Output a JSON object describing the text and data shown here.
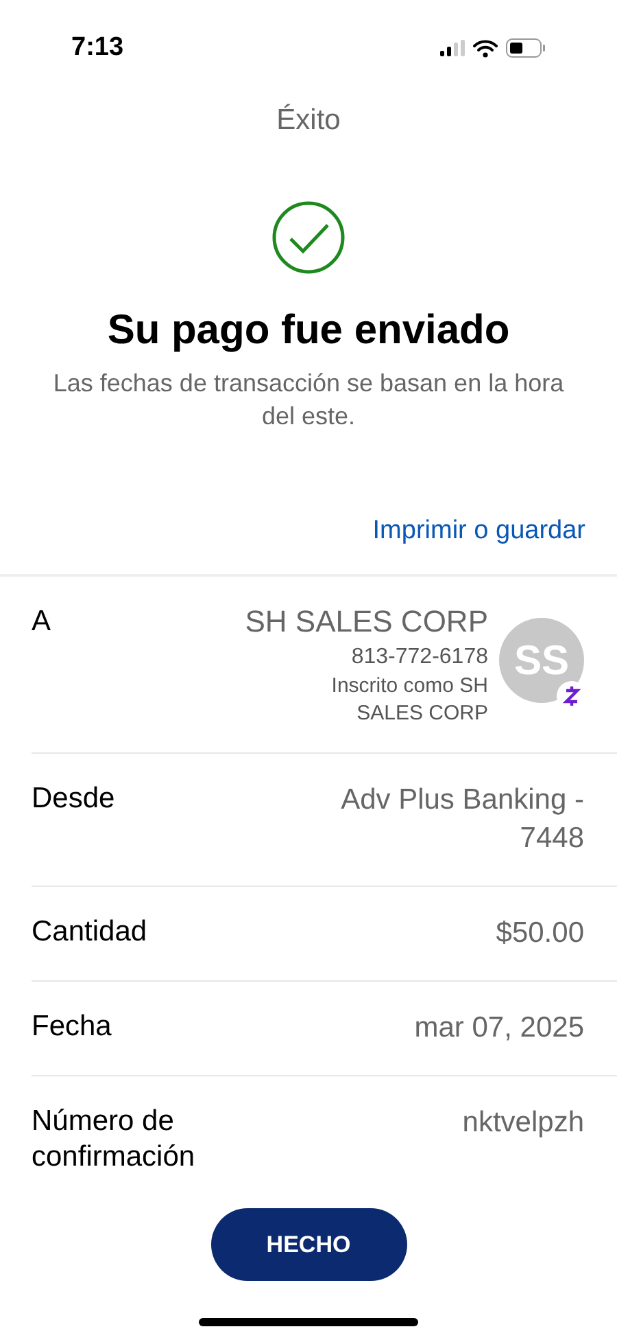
{
  "status_bar": {
    "time": "7:13"
  },
  "header": {
    "title": "Éxito"
  },
  "confirmation": {
    "heading": "Su pago fue enviado",
    "subtitle": "Las fechas de transacción se basan en la hora del este."
  },
  "print_link": "Imprimir o guardar",
  "details": [
    {
      "kind": "payee",
      "label": "A",
      "name": "SH SALES CORP",
      "phone": "813-772-6178",
      "enrolled": "Inscrito como SH SALES CORP",
      "initials": "SS"
    },
    {
      "kind": "plain",
      "label": "Desde",
      "value": "Adv Plus Banking - 7448"
    },
    {
      "kind": "plain",
      "label": "Cantidad",
      "value": "$50.00"
    },
    {
      "kind": "plain",
      "label": "Fecha",
      "value": "mar 07, 2025"
    },
    {
      "kind": "plain",
      "label": "Número de confirmación",
      "value": "nktvelpzh"
    }
  ],
  "done_button": "HECHO"
}
